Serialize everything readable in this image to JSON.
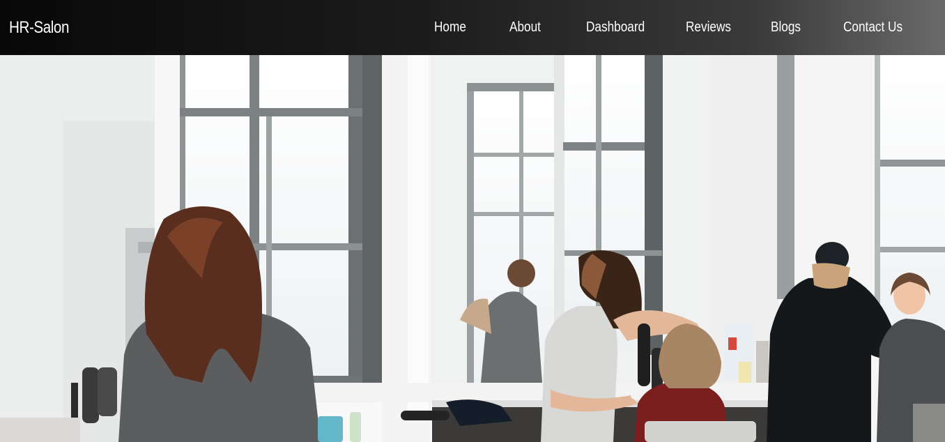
{
  "brand": {
    "name": "HR-Salon"
  },
  "nav": {
    "items": [
      {
        "label": "Home"
      },
      {
        "label": "About"
      },
      {
        "label": "Dashboard"
      },
      {
        "label": "Reviews"
      },
      {
        "label": "Blogs"
      },
      {
        "label": "Contact Us"
      }
    ]
  },
  "hero": {
    "image_subject": "salon-interior-photo"
  },
  "colors": {
    "navbar_start": "#080808",
    "navbar_end": "#6a6a6a",
    "nav_text": "#ffffff"
  }
}
